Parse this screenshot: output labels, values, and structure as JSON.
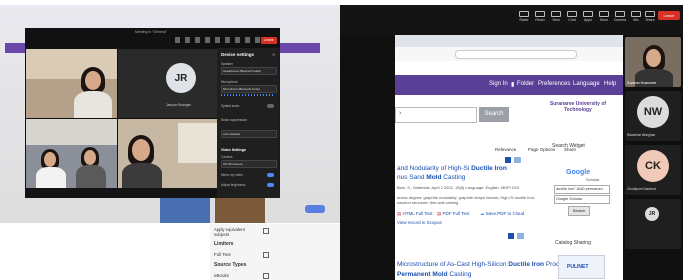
{
  "left_window": {
    "title": "Meeting in \"General\"",
    "leave_label": "Leave",
    "participant_initials": "JR",
    "participant_name": "Jatupon Ruangsri"
  },
  "device_settings": {
    "title": "Device settings",
    "speaker_label": "Speaker",
    "speaker_value": "Headphones (Bluetooth Audio)",
    "microphone_label": "Microphone",
    "microphone_value": "Microphone (Bluetooth Audio)",
    "spatial_audio_label": "Spatial audio",
    "noise_suppression_label": "Noise suppression",
    "noise_value": "Auto (default)",
    "video_settings_label": "Video Settings",
    "camera_label": "Camera",
    "camera_value": "HP HD Camera",
    "mirror_label": "Mirror my video",
    "adjust_label": "Adjust brightness"
  },
  "right_toolbar": {
    "items": [
      "Raise",
      "React",
      "View",
      "Chat",
      "Apps",
      "More",
      "Camera",
      "Mic",
      "Share"
    ],
    "leave_label": "Leave"
  },
  "library": {
    "nav": [
      "Sign In",
      "Folder",
      "Preferences",
      "Language",
      "Help"
    ],
    "university": "Suranaree University of Technology",
    "search_button": "Search",
    "toolbar": [
      "Relevance",
      "Page Options",
      "Share"
    ],
    "result1_title_pre": "and Nodularity of High-Si ",
    "result1_title_b1": "Ductile Iron",
    "result1_title_mid": "nus Sand ",
    "result1_title_b2": "Mold",
    "result1_title_post": " Casting",
    "result1_meta": "Bian, S., Materials, April 2 2022, 15(8) Language: English. MDPI DOI",
    "result1_abs": "dness degree; graphite nodularity; graphite shape factors; High-Si ductile iron; solution structure; thin-wall casting",
    "html_full_text": "HTML Full Text",
    "pdf_full_text": "PDF Full Text",
    "save_pdf": "Save PDF to Cloud",
    "view_scopus": "View record in Scopus",
    "result2_title_pre": "Microstructure of As-Cast High-Silicon ",
    "result2_title_b1": "Ductile Iron",
    "result2_title_post": " Produced via",
    "result2_title_b2": "Permanent Mold",
    "result2_title_end": " Casting",
    "widget_title": "Search Widget",
    "widget_google": "Google",
    "widget_scholar": "Scholar",
    "widget_query": "ductile iron\" AND permanen",
    "widget_select": "Google Scholar",
    "widget_button": "Search",
    "catalog_sharing": "Catalog Sharing",
    "pulinet": "PULINET"
  },
  "right_participants": {
    "p1_name": "Supanan Noomanee",
    "p2_initials": "NW",
    "p2_name": "Niwatchai Wonghan",
    "p3_initials": "CK",
    "p3_name": "Chootiporn Kaewrod",
    "p4_initials": "JR"
  },
  "left_sidebar": {
    "p_initials": "JR"
  },
  "filters": {
    "apply": "Apply equivalent subjects",
    "limiters": "Limiters",
    "full_text": "Full Text",
    "source_types": "Source Types",
    "ebooks": "eBooks"
  },
  "colors": {
    "zoom_dark": "#1b1b1b",
    "leave_red": "#d93025",
    "nav_purple": "#5a3f97",
    "link_blue": "#1a4fb0"
  }
}
